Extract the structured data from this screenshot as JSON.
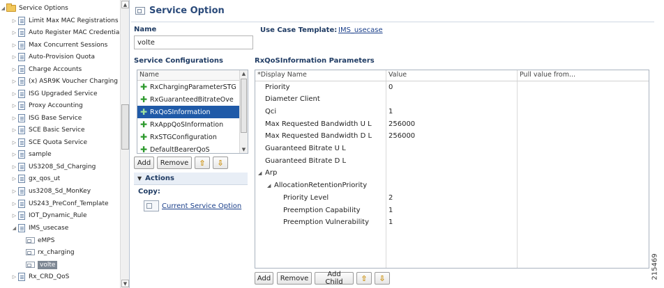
{
  "tree": {
    "items": [
      {
        "label": "Service Options",
        "icon": "folder-open-icon",
        "expanded": true
      },
      {
        "label": "Limit Max MAC Registrations",
        "icon": "document-icon"
      },
      {
        "label": "Auto Register MAC Credentia",
        "icon": "document-icon"
      },
      {
        "label": "Max Concurrent Sessions",
        "icon": "document-icon"
      },
      {
        "label": "Auto-Provision Quota",
        "icon": "document-icon"
      },
      {
        "label": "Charge Accounts",
        "icon": "document-icon"
      },
      {
        "label": "(x) ASR9K Voucher Charging",
        "icon": "document-icon"
      },
      {
        "label": "ISG Upgraded Service",
        "icon": "document-icon"
      },
      {
        "label": "Proxy Accounting",
        "icon": "document-icon"
      },
      {
        "label": "ISG Base Service",
        "icon": "document-icon"
      },
      {
        "label": "SCE Basic Service",
        "icon": "document-icon"
      },
      {
        "label": "SCE Quota Service",
        "icon": "document-icon"
      },
      {
        "label": "sample",
        "icon": "document-icon"
      },
      {
        "label": "US3208_Sd_Charging",
        "icon": "document-icon"
      },
      {
        "label": "gx_qos_ut",
        "icon": "document-icon"
      },
      {
        "label": "us3208_Sd_MonKey",
        "icon": "document-icon"
      },
      {
        "label": "US243_PreConf_Template",
        "icon": "document-icon"
      },
      {
        "label": "IOT_Dynamic_Rule",
        "icon": "document-icon"
      },
      {
        "label": "IMS_usecase",
        "icon": "document-icon"
      },
      {
        "label": "eMPS",
        "icon": "service-option-icon"
      },
      {
        "label": "rx_charging",
        "icon": "service-option-icon"
      },
      {
        "label": "volte",
        "icon": "service-option-icon",
        "selected": true
      },
      {
        "label": "Rx_CRD_QoS",
        "icon": "document-icon"
      }
    ]
  },
  "header": {
    "title": "Service Option"
  },
  "name": {
    "label": "Name",
    "value": "volte"
  },
  "use_case_template": {
    "label": "Use Case Template:",
    "value": "IMS_usecase"
  },
  "service_configurations": {
    "title": "Service Configurations",
    "column": "Name",
    "items": [
      {
        "label": "RxChargingParameterSTG"
      },
      {
        "label": "RxGuaranteedBitrateOve"
      },
      {
        "label": "RxQoSInformation",
        "selected": true
      },
      {
        "label": "RxAppQoSInformation"
      },
      {
        "label": "RxSTGConfiguration"
      },
      {
        "label": "DefaultBearerQoS"
      }
    ],
    "buttons": {
      "add": "Add",
      "remove": "Remove"
    }
  },
  "actions": {
    "title": "Actions",
    "copy_label": "Copy:",
    "copy_link": "Current Service Option"
  },
  "parameters": {
    "title": "RxQoSInformation Parameters",
    "columns": [
      "*Display Name",
      "Value",
      "Pull value from..."
    ],
    "rows": [
      {
        "name": "Priority",
        "value": "0",
        "indent": 0
      },
      {
        "name": "Diameter Client",
        "value": "",
        "indent": 0
      },
      {
        "name": "Qci",
        "value": "1",
        "indent": 0
      },
      {
        "name": "Max Requested Bandwidth U L",
        "value": "256000",
        "indent": 0
      },
      {
        "name": "Max Requested Bandwidth D L",
        "value": "256000",
        "indent": 0
      },
      {
        "name": "Guaranteed Bitrate U L",
        "value": "",
        "indent": 0
      },
      {
        "name": "Guaranteed Bitrate D L",
        "value": "",
        "indent": 0
      },
      {
        "name": "Arp",
        "value": "",
        "indent": 0,
        "expandable": true
      },
      {
        "name": "AllocationRetentionPriority",
        "value": "",
        "indent": 1,
        "expandable": true
      },
      {
        "name": "Priority Level",
        "value": "2",
        "indent": 2
      },
      {
        "name": "Preemption Capability",
        "value": "1",
        "indent": 2
      },
      {
        "name": "Preemption Vulnerability",
        "value": "1",
        "indent": 2
      }
    ],
    "buttons": {
      "add": "Add",
      "remove": "Remove",
      "add_child": "Add Child"
    }
  },
  "watermark": "215469"
}
